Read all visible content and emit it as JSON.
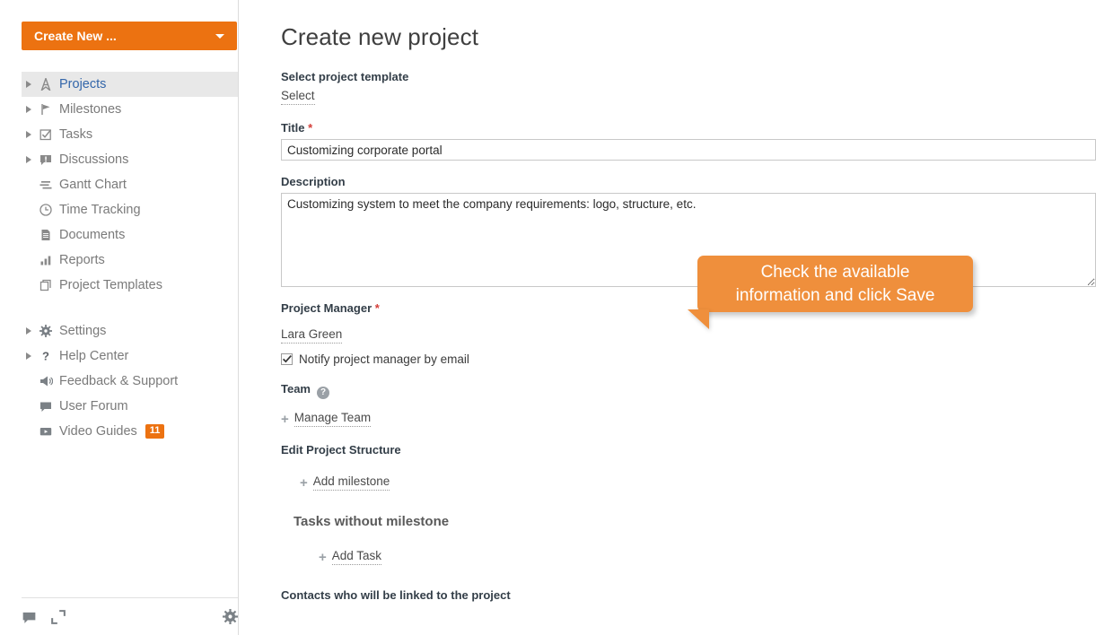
{
  "sidebar": {
    "create_button": {
      "label": "Create New ...",
      "icon": "chevron-down-icon",
      "color": "#ec7211"
    },
    "items": [
      {
        "label": "Projects",
        "icon": "projects-icon",
        "expandable": true,
        "active": true
      },
      {
        "label": "Milestones",
        "icon": "flag-icon",
        "expandable": true,
        "active": false
      },
      {
        "label": "Tasks",
        "icon": "checkbox-task-icon",
        "expandable": true,
        "active": false
      },
      {
        "label": "Discussions",
        "icon": "discussion-icon",
        "expandable": true,
        "active": false
      },
      {
        "label": "Gantt Chart",
        "icon": "gantt-chart-icon",
        "expandable": false,
        "active": false
      },
      {
        "label": "Time Tracking",
        "icon": "clock-icon",
        "expandable": false,
        "active": false
      },
      {
        "label": "Documents",
        "icon": "document-icon",
        "expandable": false,
        "active": false
      },
      {
        "label": "Reports",
        "icon": "bar-chart-icon",
        "expandable": false,
        "active": false
      },
      {
        "label": "Project Templates",
        "icon": "copy-icon",
        "expandable": false,
        "active": false
      }
    ],
    "secondary_items": [
      {
        "label": "Settings",
        "icon": "gear-icon",
        "expandable": true,
        "badge": ""
      },
      {
        "label": "Help Center",
        "icon": "question-icon",
        "expandable": true,
        "badge": ""
      },
      {
        "label": "Feedback & Support",
        "icon": "megaphone-icon",
        "expandable": false,
        "badge": ""
      },
      {
        "label": "User Forum",
        "icon": "chat-bubble-icon",
        "expandable": false,
        "badge": ""
      },
      {
        "label": "Video Guides",
        "icon": "video-icon",
        "expandable": false,
        "badge": "11"
      }
    ],
    "footer_icons": [
      {
        "name": "chat-bubble-icon"
      },
      {
        "name": "expand-icon"
      },
      {
        "name": "gear-icon"
      }
    ]
  },
  "main": {
    "page_title": "Create new project",
    "template": {
      "label": "Select project template",
      "select_link": "Select"
    },
    "title_field": {
      "label": "Title",
      "required_mark": "*",
      "value": "Customizing corporate portal",
      "placeholder": ""
    },
    "description_field": {
      "label": "Description",
      "value": "Customizing system to meet the company requirements: logo, structure, etc.",
      "placeholder": ""
    },
    "project_manager": {
      "label": "Project Manager",
      "required_mark": "*",
      "value": "Lara Green",
      "notify_label": "Notify project manager by email",
      "notify_checked": true
    },
    "team": {
      "label": "Team",
      "help_icon": "question-circle-icon",
      "manage_link": "Manage Team",
      "plus_icon": "plus-icon"
    },
    "structure": {
      "label": "Edit Project Structure",
      "add_milestone": "Add milestone",
      "tasks_without_milestone": "Tasks without milestone",
      "add_task": "Add Task",
      "plus_icon": "plus-icon"
    },
    "contacts": {
      "label": "Contacts who will be linked to the project"
    }
  },
  "tooltip": {
    "text": "Check the available\ninformation and click Save",
    "color": "#ef8f3c"
  }
}
